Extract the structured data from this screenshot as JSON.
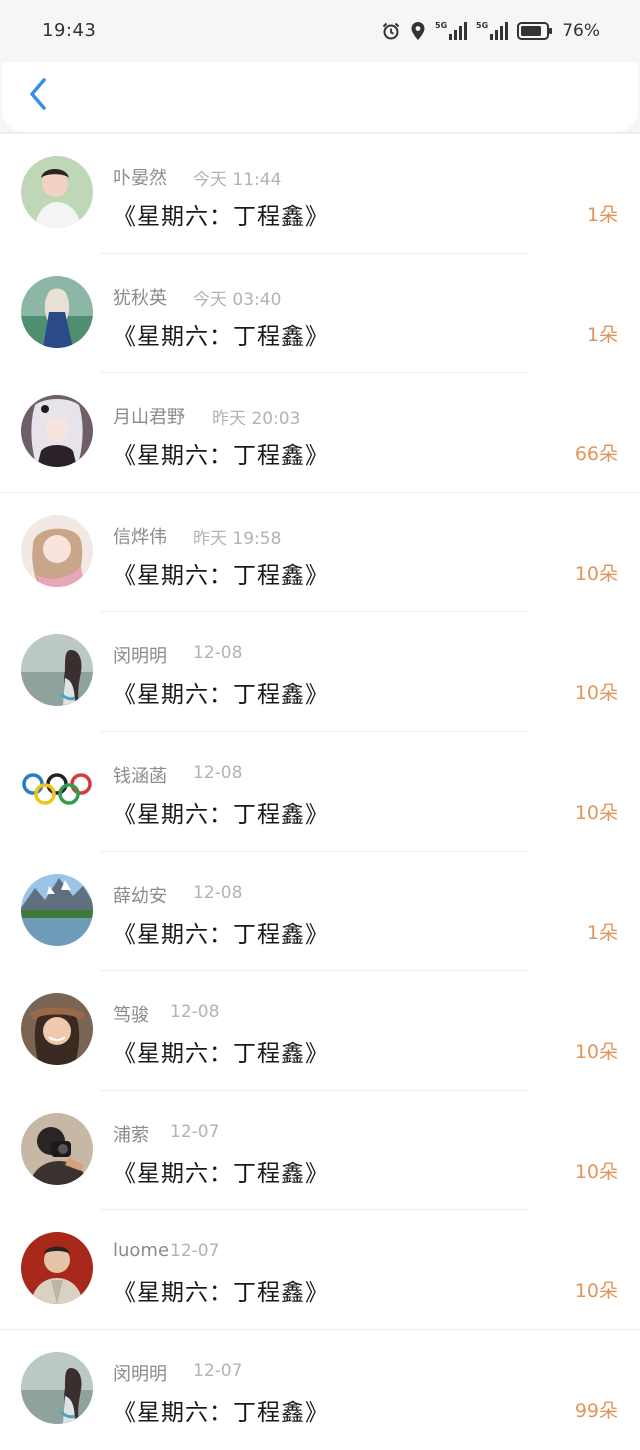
{
  "status": {
    "time": "19:43",
    "battery": "76%",
    "network": "5G"
  },
  "nav": {
    "back_icon": "chevron-left-icon",
    "accent": "#3a8ee6"
  },
  "colors": {
    "count": "#e2955a",
    "name": "#8b8b8b",
    "time": "#b3b3b3"
  },
  "items": [
    {
      "name": "卟晏然",
      "time": "今天 11:44",
      "title": "《星期六：丁程鑫》",
      "count": "1朵"
    },
    {
      "name": "犹秋英",
      "time": "今天 03:40",
      "title": "《星期六：丁程鑫》",
      "count": "1朵"
    },
    {
      "name": "月山君野",
      "time": "昨天 20:03",
      "title": "《星期六：丁程鑫》",
      "count": "66朵"
    },
    {
      "name": "信烨伟",
      "time": "昨天 19:58",
      "title": "《星期六：丁程鑫》",
      "count": "10朵"
    },
    {
      "name": "闵明明",
      "time": "12-08",
      "title": "《星期六：丁程鑫》",
      "count": "10朵"
    },
    {
      "name": "钱涵菡",
      "time": "12-08",
      "title": "《星期六：丁程鑫》",
      "count": "10朵"
    },
    {
      "name": "薛幼安",
      "time": "12-08",
      "title": "《星期六：丁程鑫》",
      "count": "1朵"
    },
    {
      "name": "笃骏",
      "time": "12-08",
      "title": "《星期六：丁程鑫》",
      "count": "10朵"
    },
    {
      "name": "浦萦",
      "time": "12-07",
      "title": "《星期六：丁程鑫》",
      "count": "10朵"
    },
    {
      "name": "luome",
      "time": "12-07",
      "title": "《星期六：丁程鑫》",
      "count": "10朵"
    },
    {
      "name": "闵明明",
      "time": "12-07",
      "title": "《星期六：丁程鑫》",
      "count": "99朵"
    }
  ]
}
